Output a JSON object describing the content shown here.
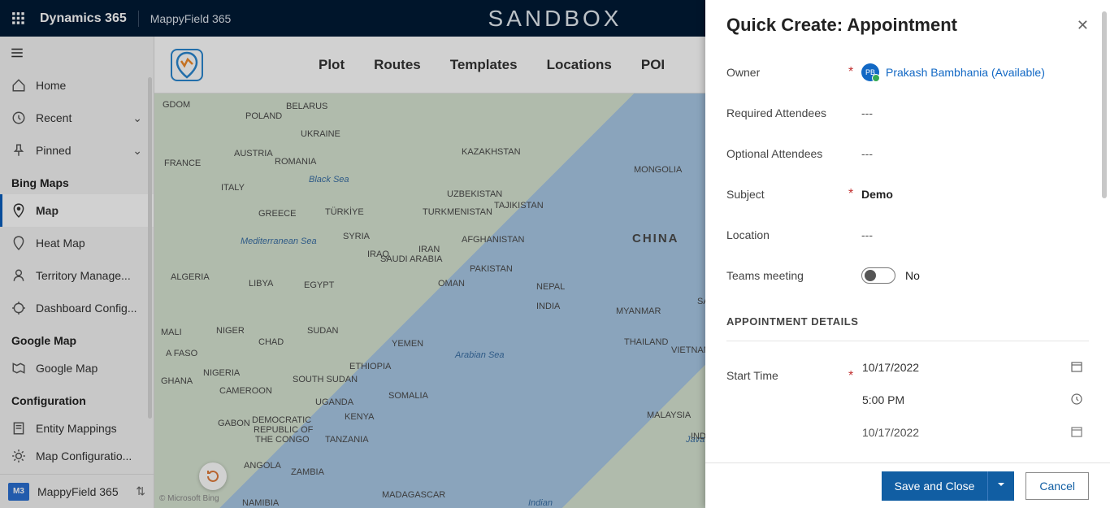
{
  "topbar": {
    "brand": "Dynamics 365",
    "app": "MappyField 365",
    "env_banner": "SANDBOX"
  },
  "sidebar": {
    "home": "Home",
    "recent": "Recent",
    "pinned": "Pinned",
    "groups": {
      "bing": "Bing Maps",
      "google": "Google Map",
      "config": "Configuration"
    },
    "items": {
      "map": "Map",
      "heat": "Heat Map",
      "territory": "Territory Manage...",
      "dashboard": "Dashboard Config...",
      "google_map": "Google Map",
      "entity": "Entity Mappings",
      "mapcfg": "Map Configuratio..."
    },
    "footer": {
      "tag": "M3",
      "label": "MappyField 365"
    }
  },
  "tabs": {
    "plot": "Plot",
    "routes": "Routes",
    "templates": "Templates",
    "locations": "Locations",
    "poi": "POI"
  },
  "map_attrib": "© Microsoft Bing",
  "map_labels": {
    "gdom": "GDOM",
    "poland": "POLAND",
    "belarus": "BELARUS",
    "ukraine": "UKRAINE",
    "austria": "AUSTRIA",
    "romania": "ROMANIA",
    "italy": "ITALY",
    "france": "FRANCE",
    "greece": "GREECE",
    "turkiye": "TÜRKİYE",
    "syria": "SYRIA",
    "iraq": "IRAQ",
    "iran": "IRAN",
    "afghan": "AFGHANISTAN",
    "pakistan": "PAKISTAN",
    "india": "INDIA",
    "nepal": "NEPAL",
    "myanmar": "MYANMAR",
    "thailand": "THAILAND",
    "vietnam": "VIETNAM",
    "china": "CHINA",
    "mongolia": "MONGOLIA",
    "kazakhstan": "KAZAKHSTAN",
    "uzbek": "UZBEKISTAN",
    "turkmen": "TURKMENISTAN",
    "tajik": "TAJIKISTAN",
    "saudi": "SAUDI ARABIA",
    "oman": "OMAN",
    "yemen": "YEMEN",
    "egypt": "EGYPT",
    "libya": "LIBYA",
    "algeria": "ALGERIA",
    "mali": "MALI",
    "niger": "NIGER",
    "chad": "CHAD",
    "sudan": "SUDAN",
    "ssudan": "SOUTH SUDAN",
    "ethiopia": "ETHIOPIA",
    "somalia": "SOMALIA",
    "nigeria": "NIGERIA",
    "faso": "A FASO",
    "ghana": "GHANA",
    "cameroon": "CAMEROON",
    "gabon": "GABON",
    "drc1": "DEMOCRATIC",
    "drc2": "REPUBLIC OF",
    "drc3": "THE CONGO",
    "angola": "ANGOLA",
    "zambia": "ZAMBIA",
    "tanzania": "TANZANIA",
    "kenya": "KENYA",
    "uganda": "UGANDA",
    "madagascar": "MADAGASCAR",
    "namibia": "NAMIBIA",
    "malaysia": "MALAYSIA",
    "med": "Mediterranean Sea",
    "arab": "Arabian Sea",
    "black": "Black Sea",
    "indian": "Indian",
    "java": "Java S",
    "indo": "INDC",
    "sa": "SA"
  },
  "panel": {
    "title": "Quick Create: Appointment",
    "labels": {
      "owner": "Owner",
      "required": "Required Attendees",
      "optional": "Optional Attendees",
      "subject": "Subject",
      "location": "Location",
      "teams": "Teams meeting",
      "section": "APPOINTMENT DETAILS",
      "start": "Start Time"
    },
    "values": {
      "owner_initials": "PB",
      "owner": "Prakash Bambhania (Available)",
      "required": "---",
      "optional": "---",
      "subject": "Demo",
      "location": "---",
      "teams": "No",
      "start_date": "10/17/2022",
      "start_time": "5:00 PM",
      "end_date": "10/17/2022"
    },
    "buttons": {
      "save": "Save and Close",
      "cancel": "Cancel"
    }
  }
}
